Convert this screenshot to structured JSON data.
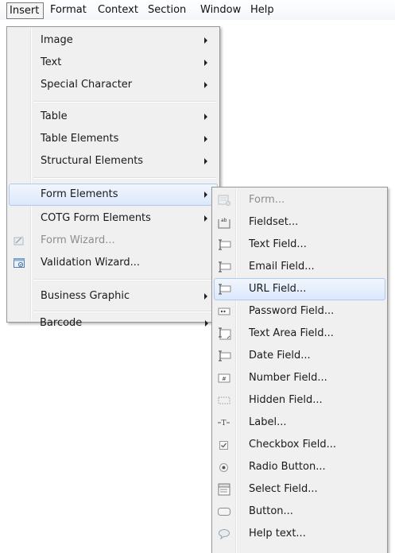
{
  "menubar": {
    "items": [
      "Insert",
      "Format",
      "Context",
      "Section",
      "Window",
      "Help"
    ]
  },
  "insert_menu": {
    "items": [
      {
        "label": "Image",
        "submenu": true
      },
      {
        "label": "Text",
        "submenu": true
      },
      {
        "label": "Special Character",
        "submenu": true
      },
      {
        "label": "Table",
        "submenu": true
      },
      {
        "label": "Table Elements",
        "submenu": true
      },
      {
        "label": "Structural Elements",
        "submenu": true
      },
      {
        "label": "Form Elements",
        "submenu": true,
        "state": "highlighted"
      },
      {
        "label": "COTG Form Elements",
        "submenu": true
      },
      {
        "label": "Form Wizard...",
        "state": "disabled",
        "icon": "form-wizard-icon"
      },
      {
        "label": "Validation Wizard...",
        "icon": "validation-wizard-icon"
      },
      {
        "label": "Business Graphic",
        "submenu": true
      },
      {
        "label": "Barcode",
        "submenu": true
      }
    ]
  },
  "form_submenu": {
    "items": [
      {
        "label": "Form...",
        "state": "disabled",
        "icon": "form-icon"
      },
      {
        "label": "Fieldset...",
        "icon": "fieldset-icon"
      },
      {
        "label": "Text Field...",
        "icon": "text-field-icon"
      },
      {
        "label": "Email Field...",
        "icon": "email-field-icon"
      },
      {
        "label": "URL Field...",
        "icon": "url-field-icon",
        "state": "highlighted"
      },
      {
        "label": "Password Field...",
        "icon": "password-field-icon"
      },
      {
        "label": "Text Area Field...",
        "icon": "text-area-icon"
      },
      {
        "label": "Date Field...",
        "icon": "date-field-icon"
      },
      {
        "label": "Number Field...",
        "icon": "number-field-icon"
      },
      {
        "label": "Hidden Field...",
        "icon": "hidden-field-icon"
      },
      {
        "label": "Label...",
        "icon": "label-icon"
      },
      {
        "label": "Checkbox Field...",
        "icon": "checkbox-icon"
      },
      {
        "label": "Radio Button...",
        "icon": "radio-button-icon"
      },
      {
        "label": "Select Field...",
        "icon": "select-field-icon"
      },
      {
        "label": "Button...",
        "icon": "button-icon"
      },
      {
        "label": "Help text...",
        "icon": "help-text-icon"
      }
    ]
  },
  "colors": {
    "menu_bg": "#f0f0f0",
    "highlight_bg": "#dbe8fb",
    "highlight_border": "#aecaf0",
    "disabled_text": "#8d8d8d"
  }
}
